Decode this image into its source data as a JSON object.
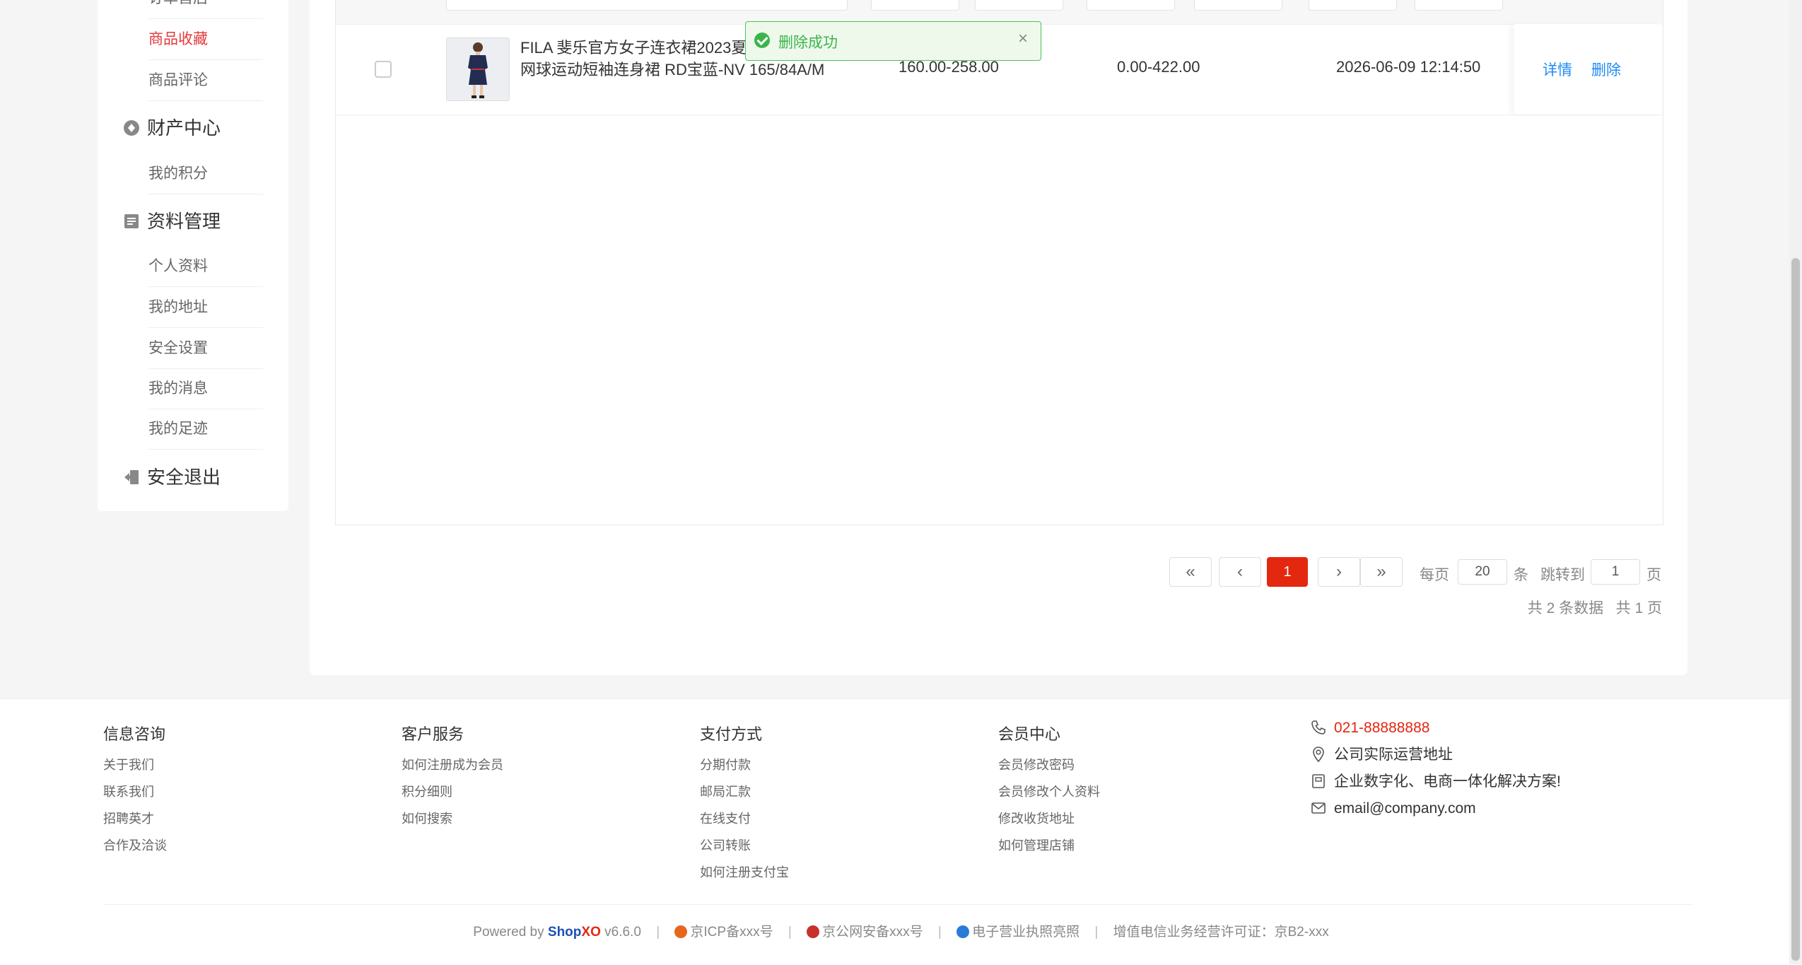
{
  "sidebar": {
    "partial_item": "订单售后",
    "items_top": [
      "商品收藏",
      "商品评论"
    ],
    "groups": [
      {
        "label": "财产中心",
        "icon": "wallet-icon",
        "items": [
          "我的积分"
        ]
      },
      {
        "label": "资料管理",
        "icon": "profile-icon",
        "items": [
          "个人资料",
          "我的地址",
          "安全设置",
          "我的消息",
          "我的足迹"
        ]
      }
    ],
    "logout": {
      "label": "安全退出",
      "icon": "logout-icon"
    },
    "active_color": "#e4393c"
  },
  "toast": {
    "message": "删除成功",
    "close": "×",
    "color": "#3bb54a"
  },
  "table": {
    "rows": [
      {
        "name_line1": "FILA 斐乐官方女子连衣裙2023夏季",
        "name_line2": "网球运动短袖连身裙 RD宝蓝-NV 165/84A/M",
        "price": "160.00-258.00",
        "original_price": "0.00-422.00",
        "time": "2026-06-09 12:14:50",
        "action_detail": "详情",
        "action_delete": "删除"
      }
    ]
  },
  "pagination": {
    "first": "«",
    "prev": "‹",
    "current": "1",
    "next": "›",
    "last": "»",
    "per_page_label": "每页",
    "per_page_value": "20",
    "per_page_unit": "条",
    "jump_label": "跳转到",
    "jump_value": "1",
    "jump_unit": "页",
    "summary": "共 2 条数据   共 1 页",
    "accent": "#e4270f"
  },
  "footer": {
    "columns": [
      {
        "title": "信息咨询",
        "links": [
          "关于我们",
          "联系我们",
          "招聘英才",
          "合作及洽谈"
        ]
      },
      {
        "title": "客户服务",
        "links": [
          "如何注册成为会员",
          "积分细则",
          "如何搜索"
        ]
      },
      {
        "title": "支付方式",
        "links": [
          "分期付款",
          "邮局汇款",
          "在线支付",
          "公司转账",
          "如何注册支付宝"
        ]
      },
      {
        "title": "会员中心",
        "links": [
          "会员修改密码",
          "会员修改个人资料",
          "修改收货地址",
          "如何管理店铺"
        ]
      }
    ],
    "contact": {
      "phone": "021-88888888",
      "address": "公司实际运营地址",
      "slogan": "企业数字化、电商一体化解决方案!",
      "email": "email@company.com"
    },
    "bottom": {
      "powered_prefix": "Powered by",
      "brand_a": "Shop",
      "brand_b": "XO",
      "version": "v6.6.0",
      "icp": "京ICP备xxx号",
      "police": "京公网安备xxx号",
      "license": "电子营业执照亮照",
      "telecom": "增值电信业务经营许可证：京B2-xxx"
    }
  }
}
